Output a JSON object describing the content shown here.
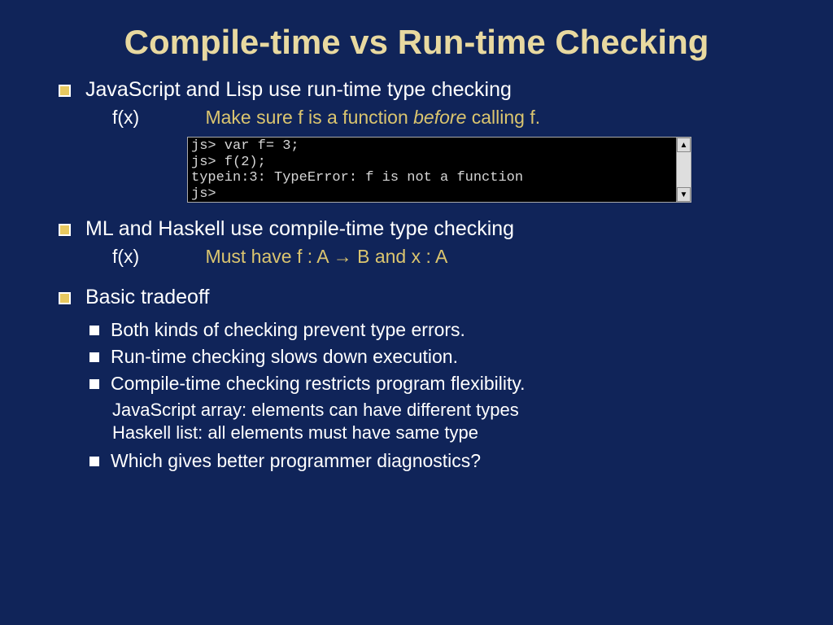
{
  "title": "Compile-time vs Run-time Checking",
  "bullet1": {
    "text": "JavaScript and Lisp use run-time type checking",
    "fx": "f(x)",
    "note_pre": "Make sure f is a function ",
    "note_em": "before",
    "note_post": "  calling f."
  },
  "console": {
    "line1": "js> var f= 3;",
    "line2": "js> f(2);",
    "line3": "typein:3: TypeError: f is not a function",
    "line4": "js>"
  },
  "bullet2": {
    "text": "ML and Haskell use compile-time type checking",
    "fx": "f(x)",
    "note": "Must have f : A → B and x : A"
  },
  "bullet3": {
    "text": "Basic tradeoff",
    "sub1": "Both kinds of checking prevent type errors.",
    "sub2": "Run-time checking slows down execution.",
    "sub3": "Compile-time checking restricts program flexibility.",
    "sub3a": "JavaScript array: elements can have different types",
    "sub3b": "Haskell list: all elements must have same type",
    "sub4": "Which gives better programmer diagnostics?"
  }
}
